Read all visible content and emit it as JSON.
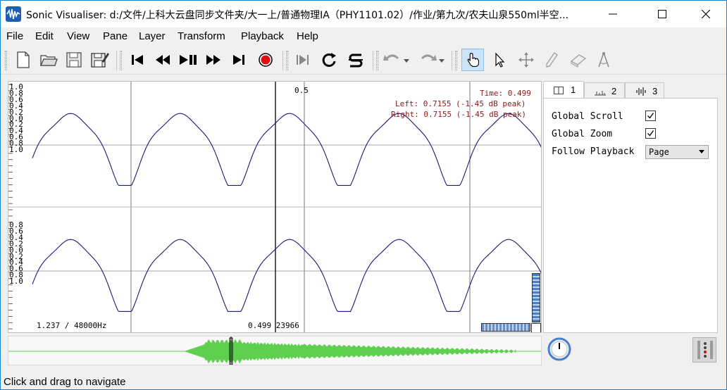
{
  "window": {
    "title": "Sonic Visualiser: d:/文件/上科大云盘同步文件夹/大一上/普通物理IA（PHY1101.02）/作业/第九次/农夫山泉550ml半空..."
  },
  "menu": {
    "file": "File",
    "edit": "Edit",
    "view": "View",
    "pane": "Pane",
    "layer": "Layer",
    "transform": "Transform",
    "playback": "Playback",
    "help": "Help"
  },
  "toolbar": {
    "icons": [
      "new-file-icon",
      "open-folder-icon",
      "save-icon",
      "save-as-icon",
      "skip-to-start-icon",
      "rewind-icon",
      "play-pause-icon",
      "fast-forward-icon",
      "skip-to-end-icon",
      "record-icon",
      "play-selection-icon",
      "loop-icon",
      "solo-icon",
      "undo-icon",
      "redo-icon",
      "navigate-hand-icon",
      "select-arrow-icon",
      "move-icon",
      "draw-pencil-icon",
      "erase-icon",
      "measure-icon"
    ]
  },
  "pane": {
    "scale_top": [
      "1.0",
      "0.8",
      "0.6",
      "0.4",
      "0.2",
      "0.0",
      "0.2",
      "0.4",
      "0.6",
      "0.8",
      "1.0"
    ],
    "scale_bottom": [
      "0.8",
      "0.6",
      "0.4",
      "0.2",
      "0.0",
      "0.2",
      "0.4",
      "0.6",
      "0.8",
      "1.0"
    ],
    "cursor_label": "0.5",
    "time_text": "Time: 0.499",
    "left_text": "Left: 0.7155 (-1.45 dB peak)",
    "right_text": "Right: 0.7155 (-1.45 dB peak)",
    "zoom_text": "1.237 / 48000Hz",
    "position_text": "0.499 23966",
    "waveform_color": "#1a1a7a",
    "text_color_red": "#8b1a1a"
  },
  "properties": {
    "tabs": [
      {
        "label": "1",
        "icon": "layout-icon"
      },
      {
        "label": "2",
        "icon": "ruler-icon"
      },
      {
        "label": "3",
        "icon": "waveform-icon"
      }
    ],
    "global_scroll_label": "Global Scroll",
    "global_scroll_checked": true,
    "global_zoom_label": "Global Zoom",
    "global_zoom_checked": true,
    "follow_playback_label": "Follow Playback",
    "follow_playback_value": "Page"
  },
  "overview": {
    "waveform_color": "#5fcf4f"
  },
  "status": {
    "text": "Click and drag to navigate"
  }
}
